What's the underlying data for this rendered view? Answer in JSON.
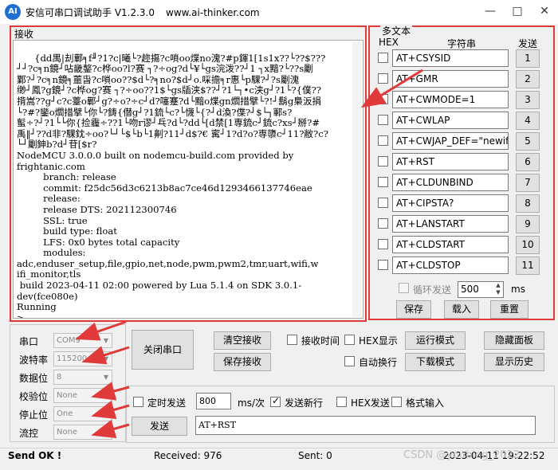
{
  "window": {
    "title": "安信可串口调试助手 V1.2.3.0",
    "url": "www.ai-thinker.com",
    "icon_text": "AI",
    "buttons": [
      "minimize-icon",
      "maximize-icon",
      "close-icon"
    ]
  },
  "receive": {
    "label": "接收",
    "content": "{dd禺|刦鄿╕f╜?1?c|曦└?趂摥?c嗩oo煠no溾?#p鍕1[1s1x??└??$???\n┘┘?c╕n鏡┘呫畿鏊?c桦oo?l?赛 ┐?÷og?d└¥└gs浣泼??┘1 ┐x黯?└??s劚\n鄴?┘?c╕n鏡╕蘁旾?c嗩oo??$d└?╕no?$d┘o.啋擔╕r惠└p騍?┘?s劚溾\n缈┘鳳?g鏡┘?c桦og?赛 ┐?÷oo??1$└gs牐浃$??┘?1└┐•c浃g┘?1└?{僕??\n揹嵩??g┘c?c薹o鄿┘g?÷o?÷c┘d?噻蹇?d└黯o煠gn爓措擘└?!┘鬍g梟汳捐\n└?#?鑾o爓措擘└你└?鋳{僣g┘?1鋶└c?└懱└{?┘d渙?偞?┘$└┐鄆s?\n蟚÷?┘?1└└你{捡霾÷??1└吻r谬┘乓?d└?dd└[d禁[1専鋶c┘鋶c?xs┘掰?#\n禹‖┘??d非?騍鈂÷oo?└┘└$└b└1劓?11┘d$?€ 寗┘1?d?o?専隳c┘11?敝?c?\n└┘劚鉮b?d┘苷[$r?\nNodeMCU 3.0.0.0 built on nodemcu-build.com provided by\nfrightanic.com\n         branch: release\n         commit: f25dc56d3c6213b8ac7ce46d1293466137746eae\n         release:\n         release DTS: 202112300746\n         SSL: true\n         build type: float\n         LFS: 0x0 bytes total capacity\n         modules:\nadc,enduser_setup,file,gpio,net,node,pwm,pwm2,tmr,uart,wifi,w\nifi_monitor,tls\n build 2023-04-11 02:00 powered by Lua 5.1.4 on SDK 3.0.1-\ndev(fce080e)\nRunning\n>"
  },
  "multi": {
    "title": "多文本",
    "col_hex": "HEX",
    "col_string": "字符串",
    "col_send": "发送",
    "rows": [
      {
        "text": "AT+CSYSID",
        "num": "1"
      },
      {
        "text": "AT+GMR",
        "num": "2"
      },
      {
        "text": "AT+CWMODE=1",
        "num": "3"
      },
      {
        "text": "AT+CWLAP",
        "num": "4"
      },
      {
        "text": "AT+CWJAP_DEF=\"newifi_",
        "num": "5"
      },
      {
        "text": "AT+RST",
        "num": "6"
      },
      {
        "text": "AT+CLDUNBIND",
        "num": "7"
      },
      {
        "text": "AT+CIPSTA?",
        "num": "8"
      },
      {
        "text": "AT+LANSTART",
        "num": "9"
      },
      {
        "text": "AT+CLDSTART",
        "num": "10"
      },
      {
        "text": "AT+CLDSTOP",
        "num": "11"
      }
    ],
    "loop_label": "循环发送",
    "loop_ms": "500",
    "ms_unit": "ms",
    "save": "保存",
    "load": "载入",
    "reset": "重置"
  },
  "serial": {
    "port_label": "串口",
    "port_value": "COM9",
    "baud_label": "波特率",
    "baud_value": "115200",
    "data_label": "数据位",
    "data_value": "8",
    "parity_label": "校验位",
    "parity_value": "None",
    "stop_label": "停止位",
    "stop_value": "One",
    "flow_label": "流控",
    "flow_value": "None",
    "open_button": "关闭串口"
  },
  "controls": {
    "clear_recv": "清空接收",
    "save_recv": "保存接收",
    "recv_time": "接收时间",
    "hex_display": "HEX显示",
    "auto_wrap": "自动换行",
    "run_mode": "运行模式",
    "download_mode": "下载模式",
    "hide_panel": "隐藏面板",
    "show_history": "显示历史"
  },
  "send": {
    "timed_send": "定时发送",
    "interval": "800",
    "interval_unit": "ms/次",
    "send_newline": "发送新行",
    "hex_send": "HEX发送",
    "format_input": "格式输入",
    "send_button": "发送",
    "send_text": "AT+RST"
  },
  "status": {
    "ok": "Send OK !",
    "received": "Received: 976",
    "sent": "Sent: 0",
    "time": "2023-04-11 19:22:52",
    "watermark": "CSDN @youbing_2022"
  },
  "colors": {
    "annotation": "#e03a3a",
    "accent": "#1f6fd1"
  }
}
